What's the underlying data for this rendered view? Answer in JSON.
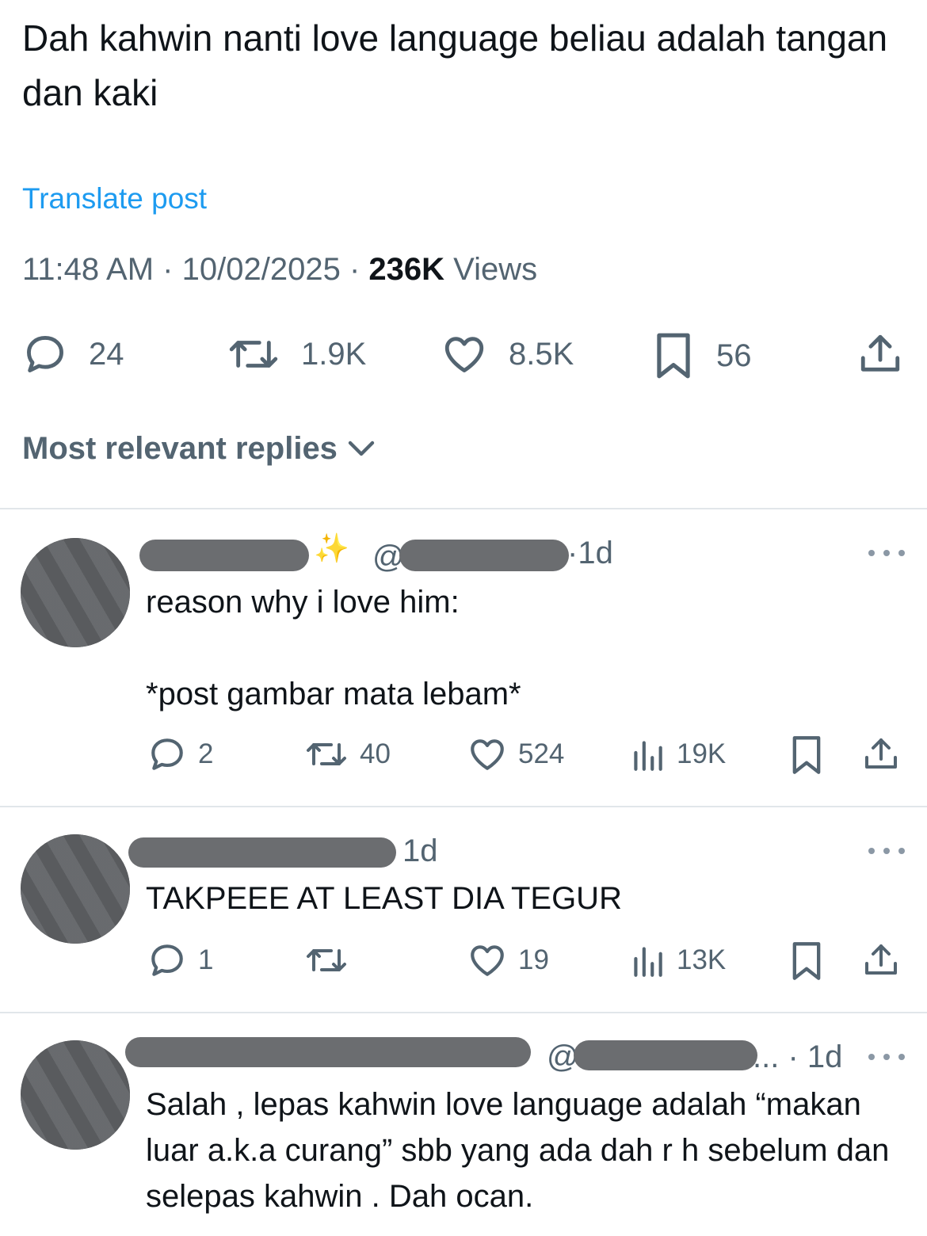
{
  "post": {
    "text": "Dah kahwin nanti love language beliau adalah tangan dan kaki",
    "translate_label": "Translate post",
    "time": "11:48 AM",
    "date": "10/02/2025",
    "views_count": "236K",
    "views_label": "Views",
    "sep": "·",
    "actions": {
      "replies": "24",
      "reposts": "1.9K",
      "likes": "8.5K",
      "bookmarks": "56"
    }
  },
  "sort": {
    "label": "Most relevant replies"
  },
  "replies": [
    {
      "time": "·1d",
      "handle_prefix": "@",
      "text": "reason why i love him:\n\n*post gambar mata lebam*",
      "stats": {
        "replies": "2",
        "reposts": "40",
        "likes": "524",
        "views": "19K"
      }
    },
    {
      "time": "1d",
      "text": "TAKPEEE AT LEAST DIA TEGUR",
      "stats": {
        "replies": "1",
        "reposts": "",
        "likes": "19",
        "views": "13K"
      }
    },
    {
      "time": "... · 1d",
      "handle_prefix": "@",
      "text": "Salah , lepas kahwin love language adalah “makan luar a.k.a curang” sbb yang ada dah r   h sebelum dan selepas kahwin . Dah ocan."
    }
  ],
  "colors": {
    "accent": "#1d9bf0",
    "muted": "#536471",
    "text": "#0f1419",
    "divider": "#e1e6ea"
  },
  "icons": [
    "reply-icon",
    "repost-icon",
    "like-icon",
    "bookmark-icon",
    "share-icon",
    "views-icon",
    "chevron-down-icon",
    "more-icon",
    "sparkles-icon"
  ]
}
